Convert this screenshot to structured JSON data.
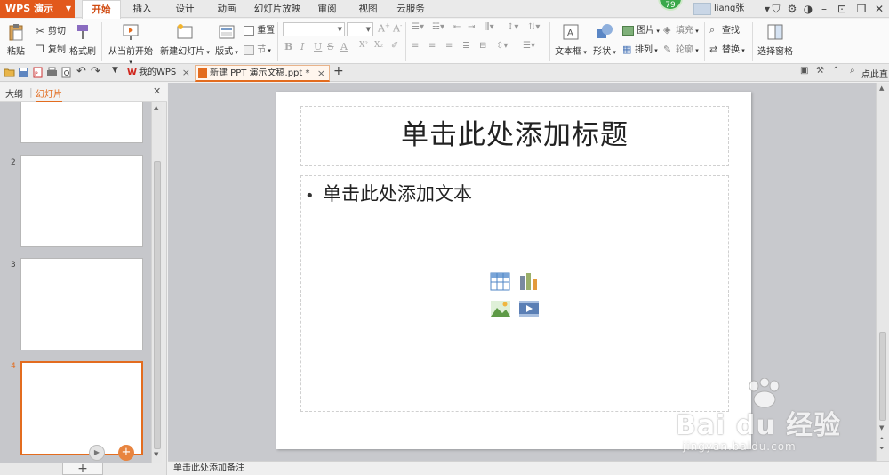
{
  "app": {
    "title": "WPS 演示"
  },
  "menu": {
    "tabs": [
      "开始",
      "插入",
      "设计",
      "动画",
      "幻灯片放映",
      "审阅",
      "视图",
      "云服务"
    ],
    "active": "开始"
  },
  "status": {
    "badge": "79"
  },
  "user": {
    "name": "liang张"
  },
  "ribbon": {
    "paste": "粘贴",
    "cut": "剪切",
    "copy": "复制",
    "format_painter": "格式刷",
    "from_current": "从当前开始",
    "new_slide": "新建幻灯片",
    "layout": "版式",
    "reset": "重置",
    "section": "节",
    "bold": "B",
    "italic": "I",
    "underline": "U",
    "strike": "S",
    "textbox": "文本框",
    "shape": "形状",
    "picture": "图片",
    "fill": "填充",
    "arrange": "排列",
    "outline": "轮廓",
    "find": "查找",
    "replace": "替换",
    "selection_pane": "选择窗格"
  },
  "tabstrip": {
    "my_wps": "我的WPS",
    "doc": "新建 PPT 演示文稿.ppt *",
    "right_label": "点此直"
  },
  "leftpanel": {
    "tab_outline": "大纲",
    "tab_slides": "幻灯片",
    "thumbnails": [
      {
        "num": "",
        "selected": false
      },
      {
        "num": "2",
        "selected": false
      },
      {
        "num": "3",
        "selected": false
      },
      {
        "num": "4",
        "selected": true
      }
    ]
  },
  "slide": {
    "title_placeholder": "单击此处添加标题",
    "body_placeholder": "单击此处添加文本",
    "bullet": "•"
  },
  "notes": {
    "placeholder": "单击此处添加备注"
  },
  "watermark": {
    "brand": "Bai du 经验",
    "url": "jingyan.baidu.com"
  },
  "colors": {
    "accent": "#e36c1f",
    "wps_orange": "#e2591c"
  }
}
